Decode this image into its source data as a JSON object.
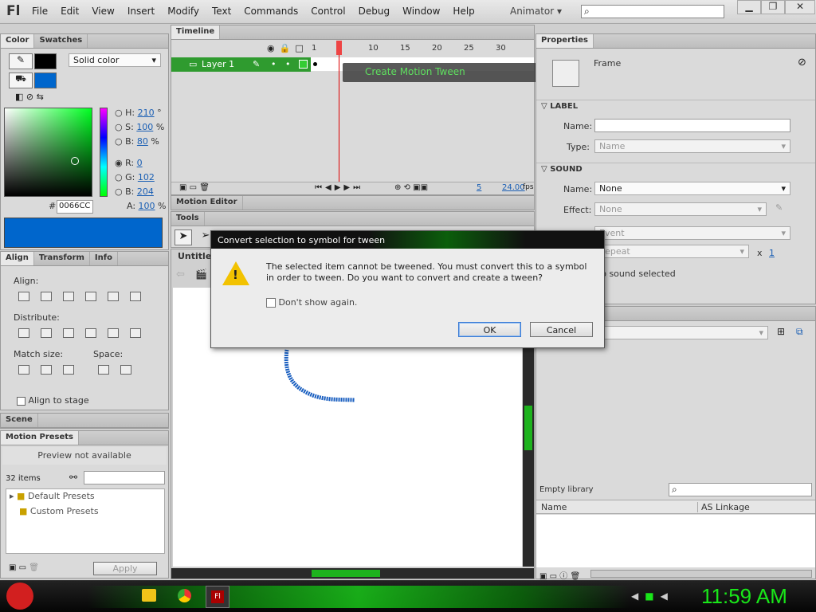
{
  "app": {
    "logo": "Fl",
    "workspace": "Animator"
  },
  "menu": [
    "File",
    "Edit",
    "View",
    "Insert",
    "Modify",
    "Text",
    "Commands",
    "Control",
    "Debug",
    "Window",
    "Help"
  ],
  "color_panel": {
    "tabs": [
      "Color",
      "Swatches"
    ],
    "fill_type": "Solid color",
    "h_label": "H:",
    "h": "210",
    "h_unit": "°",
    "s_label": "S:",
    "s": "100",
    "s_unit": "%",
    "b_label": "B:",
    "b": "80",
    "b_unit": "%",
    "r_label": "R:",
    "r": "0",
    "g_label": "G:",
    "g": "102",
    "blu_label": "B:",
    "blu": "204",
    "a_label": "A:",
    "a": "100",
    "a_unit": "%",
    "hex_label": "#",
    "hex": "0066CC",
    "swatch": "#0066cc"
  },
  "align_panel": {
    "tabs": [
      "Align",
      "Transform",
      "Info"
    ],
    "align": "Align:",
    "distribute": "Distribute:",
    "match": "Match size:",
    "space": "Space:",
    "stage": "Align to stage"
  },
  "scene_panel": {
    "title": "Scene"
  },
  "presets": {
    "title": "Motion Presets",
    "preview": "Preview not available",
    "count": "32 items",
    "items": [
      "Default Presets",
      "Custom Presets"
    ],
    "apply": "Apply"
  },
  "timeline": {
    "title": "Timeline",
    "layer": "Layer 1",
    "ticks": [
      "1",
      "5",
      "10",
      "15",
      "20",
      "25",
      "30"
    ],
    "tooltip": "Create Motion Tween",
    "frame": "5",
    "fps": "24.00",
    "fps_unit": "fps"
  },
  "motion_editor": {
    "title": "Motion Editor"
  },
  "tools": {
    "title": "Tools"
  },
  "document": {
    "tab": "Untitled"
  },
  "properties": {
    "title": "Properties",
    "frame": "Frame",
    "label_section": "LABEL",
    "name_label": "Name:",
    "type_label": "Type:",
    "type_val": "Name",
    "sound_section": "SOUND",
    "sound_name_label": "Name:",
    "sound_name": "None",
    "effect_label": "Effect:",
    "effect": "None",
    "sync": "Event",
    "repeat": "Repeat",
    "repeat_x": "x",
    "repeat_n": "1",
    "no_sound": "No sound selected"
  },
  "library": {
    "empty": "Empty library",
    "col_name": "Name",
    "col_link": "AS Linkage"
  },
  "dialog": {
    "title": "Convert selection to symbol for tween",
    "message": "The selected item cannot be tweened. You must convert this to a symbol in order to tween. Do you want to convert and create a tween?",
    "checkbox": "Don't show again.",
    "ok": "OK",
    "cancel": "Cancel"
  },
  "taskbar": {
    "clock": "11:59 AM",
    "accent": "#19e619"
  }
}
